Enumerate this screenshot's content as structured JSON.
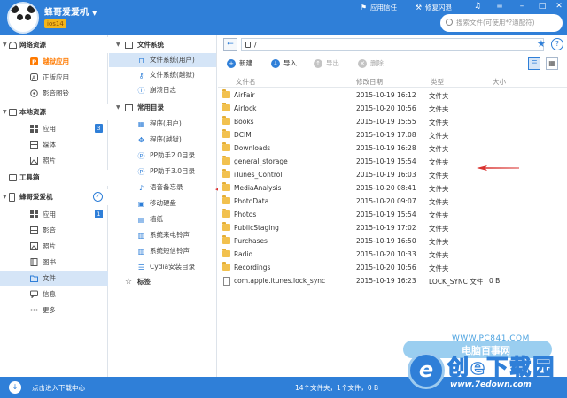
{
  "titlebar": {
    "app_name": "蜂哥爱爱机",
    "version": "ios14",
    "links": [
      {
        "label": "应用信任",
        "icon": "app-trust-icon"
      },
      {
        "label": "修复闪退",
        "icon": "fix-crash-icon"
      }
    ],
    "search_placeholder": "搜索文件(可使用*?通配符)"
  },
  "sidebar": {
    "groups": [
      {
        "label": "网络资源",
        "items": [
          {
            "label": "越狱应用",
            "highlight": true
          },
          {
            "label": "正版应用"
          },
          {
            "label": "影音图铃"
          }
        ]
      },
      {
        "label": "本地资源",
        "items": [
          {
            "label": "应用",
            "badge": "3"
          },
          {
            "label": "媒体"
          },
          {
            "label": "照片"
          }
        ]
      },
      {
        "label": "工具箱",
        "items": []
      },
      {
        "label": "蜂哥爱爱机",
        "items": [
          {
            "label": "应用",
            "badge": "1"
          },
          {
            "label": "影音"
          },
          {
            "label": "照片"
          },
          {
            "label": "图书"
          },
          {
            "label": "文件",
            "active": true
          },
          {
            "label": "信息"
          },
          {
            "label": "更多"
          }
        ]
      }
    ]
  },
  "tree": {
    "filesystem_label": "文件系统",
    "filesystem_items": [
      "文件系统(用户)",
      "文件系统(越狱)",
      "崩溃日志"
    ],
    "common_label": "常用目录",
    "common_items": [
      "程序(用户)",
      "程序(越狱)",
      "PP助手2.0目录",
      "PP助手3.0目录",
      "语音备忘录",
      "移动硬盘",
      "墙纸",
      "系统来电铃声",
      "系统短信铃声",
      "Cydia安装目录"
    ],
    "tag_label": "标签"
  },
  "pathbar": {
    "path": "/"
  },
  "toolbar": {
    "new": "新建",
    "import": "导入",
    "export": "导出",
    "delete": "删除"
  },
  "columns": {
    "name": "文件名",
    "date": "修改日期",
    "type": "类型",
    "size": "大小"
  },
  "files": [
    {
      "name": "AirFair",
      "date": "2015-10-19 16:12",
      "type": "文件夹",
      "size": "",
      "kind": "folder"
    },
    {
      "name": "Airlock",
      "date": "2015-10-20 10:56",
      "type": "文件夹",
      "size": "",
      "kind": "folder"
    },
    {
      "name": "Books",
      "date": "2015-10-19 15:55",
      "type": "文件夹",
      "size": "",
      "kind": "folder"
    },
    {
      "name": "DCIM",
      "date": "2015-10-19 17:08",
      "type": "文件夹",
      "size": "",
      "kind": "folder"
    },
    {
      "name": "Downloads",
      "date": "2015-10-19 16:28",
      "type": "文件夹",
      "size": "",
      "kind": "folder"
    },
    {
      "name": "general_storage",
      "date": "2015-10-19 15:54",
      "type": "文件夹",
      "size": "",
      "kind": "folder"
    },
    {
      "name": "iTunes_Control",
      "date": "2015-10-19 16:03",
      "type": "文件夹",
      "size": "",
      "kind": "folder"
    },
    {
      "name": "MediaAnalysis",
      "date": "2015-10-20 08:41",
      "type": "文件夹",
      "size": "",
      "kind": "folder"
    },
    {
      "name": "PhotoData",
      "date": "2015-10-20 09:07",
      "type": "文件夹",
      "size": "",
      "kind": "folder"
    },
    {
      "name": "Photos",
      "date": "2015-10-19 15:54",
      "type": "文件夹",
      "size": "",
      "kind": "folder"
    },
    {
      "name": "PublicStaging",
      "date": "2015-10-19 17:02",
      "type": "文件夹",
      "size": "",
      "kind": "folder"
    },
    {
      "name": "Purchases",
      "date": "2015-10-19 16:50",
      "type": "文件夹",
      "size": "",
      "kind": "folder"
    },
    {
      "name": "Radio",
      "date": "2015-10-20 10:33",
      "type": "文件夹",
      "size": "",
      "kind": "folder"
    },
    {
      "name": "Recordings",
      "date": "2015-10-20 10:56",
      "type": "文件夹",
      "size": "",
      "kind": "folder"
    },
    {
      "name": "com.apple.itunes.lock_sync",
      "date": "2015-10-19 16:23",
      "type": "LOCK_SYNC 文件",
      "size": "0 B",
      "kind": "file"
    }
  ],
  "statusbar": {
    "download_center": "点击进入下载中心",
    "summary": "14个文件夹，1个文件，0 B"
  },
  "watermark": {
    "url": "WWW.PC841.COM",
    "bubble": "电脑百事网",
    "title": "创e下载园",
    "site": "www.7edown.com"
  },
  "colors": {
    "accent": "#2f7fd8",
    "selected_bg": "#d5e5f7",
    "folder": "#f2c14e",
    "highlight": "#ff7a00"
  }
}
